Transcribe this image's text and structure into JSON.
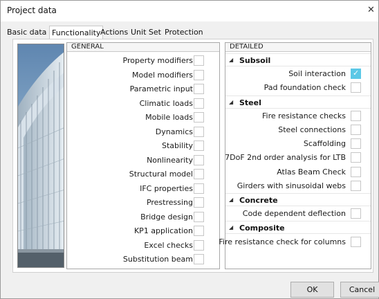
{
  "window": {
    "title": "Project data",
    "close_glyph": "✕"
  },
  "tabs": [
    {
      "label": "Basic data",
      "active": false
    },
    {
      "label": "Functionality",
      "active": true
    },
    {
      "label": "Actions",
      "active": false
    },
    {
      "label": "Unit Set",
      "active": false
    },
    {
      "label": "Protection",
      "active": false
    }
  ],
  "general": {
    "header": "GENERAL",
    "items": [
      {
        "label": "Property modifiers",
        "checked": false
      },
      {
        "label": "Model modifiers",
        "checked": false
      },
      {
        "label": "Parametric input",
        "checked": false
      },
      {
        "label": "Climatic loads",
        "checked": false
      },
      {
        "label": "Mobile loads",
        "checked": false
      },
      {
        "label": "Dynamics",
        "checked": false
      },
      {
        "label": "Stability",
        "checked": false
      },
      {
        "label": "Nonlinearity",
        "checked": false
      },
      {
        "label": "Structural model",
        "checked": false
      },
      {
        "label": "IFC properties",
        "checked": false
      },
      {
        "label": "Prestressing",
        "checked": false
      },
      {
        "label": "Bridge design",
        "checked": false
      },
      {
        "label": "KP1 application",
        "checked": false
      },
      {
        "label": "Excel checks",
        "checked": false
      },
      {
        "label": "Substitution beam",
        "checked": false
      }
    ]
  },
  "detailed": {
    "header": "DETAILED",
    "sections": [
      {
        "label": "Subsoil",
        "items": [
          {
            "label": "Soil interaction",
            "checked": true
          },
          {
            "label": "Pad foundation check",
            "checked": false
          }
        ]
      },
      {
        "label": "Steel",
        "items": [
          {
            "label": "Fire resistance checks",
            "checked": false
          },
          {
            "label": "Steel connections",
            "checked": false
          },
          {
            "label": "Scaffolding",
            "checked": false
          },
          {
            "label": "7DoF 2nd order analysis for LTB",
            "checked": false
          },
          {
            "label": "Atlas Beam Check",
            "checked": false
          },
          {
            "label": "Girders with sinusoidal webs",
            "checked": false
          }
        ]
      },
      {
        "label": "Concrete",
        "items": [
          {
            "label": "Code dependent deflection",
            "checked": false
          }
        ]
      },
      {
        "label": "Composite",
        "items": [
          {
            "label": "Fire resistance check for columns",
            "checked": false
          }
        ]
      }
    ]
  },
  "buttons": {
    "ok": "OK",
    "cancel": "Cancel"
  },
  "colors": {
    "accent_check": "#5cc8e6",
    "panel_bg": "#ffffff",
    "dialog_bg": "#f0f0f0"
  }
}
